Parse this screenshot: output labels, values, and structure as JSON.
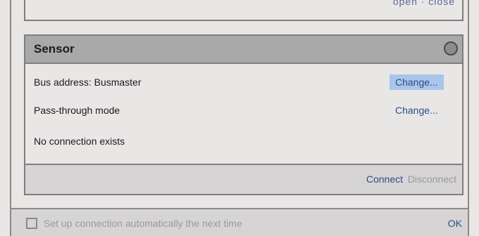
{
  "top_panel": {
    "clipped_text": "open · close"
  },
  "sensor": {
    "title": "Sensor",
    "bus_address_label": "Bus address: Busmaster",
    "bus_address_change": "Change...",
    "passthrough_label": "Pass-through mode",
    "passthrough_change": "Change...",
    "status_text": "No connection exists",
    "connect_label": "Connect",
    "disconnect_label": "Disconnect"
  },
  "footer": {
    "auto_connect_label": "Set up connection automatically the next time",
    "auto_connect_checked": false,
    "ok_label": "OK"
  },
  "colors": {
    "link": "#2a4e8c",
    "disabled": "#9a9a9a",
    "highlight": "#a9c5ea",
    "header_bg": "#a9a9a9"
  }
}
